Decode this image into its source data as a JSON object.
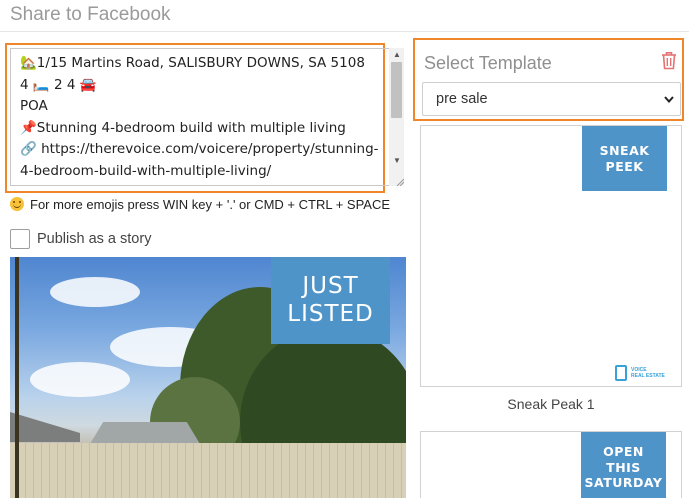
{
  "window": {
    "title": "Share to Facebook"
  },
  "caption": {
    "line1": "🏡1/15 Martins Road, SALISBURY DOWNS, SA 5108",
    "line2": "4 🛏️ 2  4 🚘",
    "line3": "POA",
    "line4": "📌Stunning 4-bedroom build with multiple living",
    "line5": "🔗 https://therevoice.com/voicere/property/stunning-4-bedroom-build-with-multiple-living/"
  },
  "hint": {
    "text": "For more emojis press WIN key + '.' or CMD + CTRL + SPACE"
  },
  "story": {
    "label": "Publish as a story",
    "checked": false
  },
  "preview": {
    "badge_line1": "JUST",
    "badge_line2": "LISTED"
  },
  "template": {
    "label": "Select Template",
    "selected": "pre sale",
    "accent": "#f0862a",
    "cards": [
      {
        "badge_lines": [
          "SNEAK",
          "PEEK"
        ],
        "logo_text": [
          "VOICE",
          "REAL ESTATE"
        ],
        "caption": "Sneak Peak 1"
      },
      {
        "badge_lines": [
          "OPEN",
          "THIS",
          "SATURDAY"
        ]
      }
    ]
  },
  "colors": {
    "badge_blue": "#4f94c9",
    "delete_red": "#e57373"
  },
  "icons": [
    "smile-icon",
    "trash-icon",
    "chevron-down-icon",
    "house-icon",
    "bed-icon",
    "car-icon",
    "pin-icon",
    "link-icon"
  ]
}
